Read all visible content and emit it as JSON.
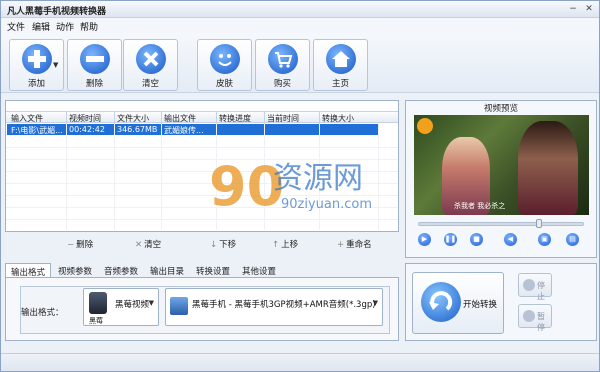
{
  "app": {
    "title": "凡人黑莓手机视频转换器",
    "win_minimize": "−",
    "win_close": "✕"
  },
  "menu": [
    "文件",
    "编辑",
    "动作",
    "帮助"
  ],
  "toolbar": {
    "add": "添加",
    "delete": "删除",
    "clear": "清空",
    "skin": "皮肤",
    "buy": "购买",
    "home": "主页"
  },
  "list": {
    "headers": [
      "输入文件",
      "视频时间",
      "文件大小",
      "输出文件",
      "转换进度",
      "当前时间",
      "转换大小"
    ],
    "rows": [
      {
        "input": "F:\\电影\\武媚...",
        "duration": "00:42:42",
        "size": "346.67MB",
        "output": "武媚娘传...",
        "progress": "",
        "current": "",
        "converted_size": ""
      }
    ]
  },
  "actions": {
    "delete": "删除",
    "clear": "清空",
    "down": "下移",
    "up": "上移",
    "rename": "重命名"
  },
  "tabs": [
    "输出格式",
    "视频参数",
    "音频参数",
    "输出目录",
    "转换设置",
    "其他设置"
  ],
  "output_format": {
    "label": "输出格式：",
    "device": "黑莓视频",
    "device_caption": "黑莓",
    "format": "黑莓手机 - 黑莓手机3GP视频+AMR音频(*.3gp)"
  },
  "preview": {
    "title": "视频预览",
    "subtitle": "杀我者 我必杀之"
  },
  "convert": {
    "start": "开始转换",
    "stop": "停止",
    "pause": "暂停"
  },
  "watermark": {
    "number": "90",
    "chinese": "资源网",
    "url": "90ziyuan.com"
  },
  "colors": {
    "accent": "#1f6fd6",
    "watermark_orange": "#e8941f",
    "watermark_blue": "#2f72c6"
  }
}
